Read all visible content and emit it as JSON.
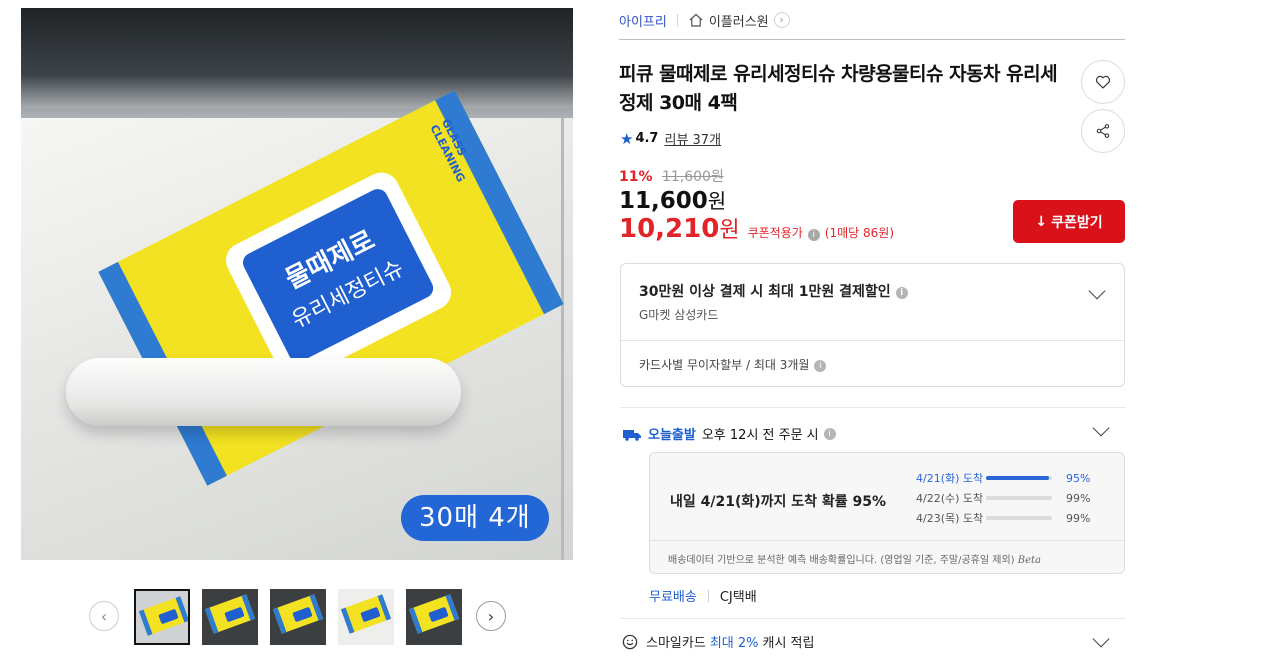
{
  "image": {
    "badge": "30매 4개",
    "pouch_line1": "물때제로",
    "pouch_line2": "유리세정티슈",
    "pouch_side": "GLASS CLEANING"
  },
  "thumbnails": [
    "thumb-1",
    "thumb-2",
    "thumb-3",
    "thumb-4",
    "thumb-5"
  ],
  "breadcrumb": {
    "store": "아이프리",
    "home_label": "이플러스원"
  },
  "product": {
    "title": "피큐 물때제로 유리세정티슈 차량용물티슈 자동차 유리세정제 30매 4팩",
    "rating": "4.7",
    "reviews": "리뷰 37개"
  },
  "price": {
    "discount_rate": "11%",
    "original": "11,600원",
    "price_value": "11,600",
    "price_unit": "원",
    "coupon_value": "10,210",
    "coupon_unit": "원",
    "coupon_note": "쿠폰적용가",
    "unit_price": "(1매당 86원)",
    "coupon_button": "쿠폰받기"
  },
  "card": {
    "title": "30만원 이상 결제 시 최대 1만원 결제할인",
    "subtitle": "G마켓 삼성카드",
    "installment": "카드사별 무이자할부 / 최대 3개월"
  },
  "shipping": {
    "today_label": "오늘출발",
    "today_desc": "오후 12시 전 주문 시",
    "main_text": "내일 4/21(화)까지 도착 확률 95%",
    "probabilities": [
      {
        "date": "4/21(화) 도착",
        "percent": "95%",
        "value": 95
      },
      {
        "date": "4/22(수) 도착",
        "percent": "99%",
        "value": 99
      },
      {
        "date": "4/23(목) 도착",
        "percent": "99%",
        "value": 99
      }
    ],
    "note": "배송데이터 기반으로 분석한 예측 배송확률입니다. (영업일 기준, 주말/공휴일 제외)",
    "beta": "Beta",
    "free_label": "무료배송",
    "carrier": "CJ택배"
  },
  "smile": {
    "prefix": "스마일카드",
    "highlight": "최대 2%",
    "suffix": "캐시 적립"
  },
  "colors": {
    "accent_blue": "#1f5fcf",
    "price_red": "#e2232a",
    "button_red": "#d9121a"
  }
}
